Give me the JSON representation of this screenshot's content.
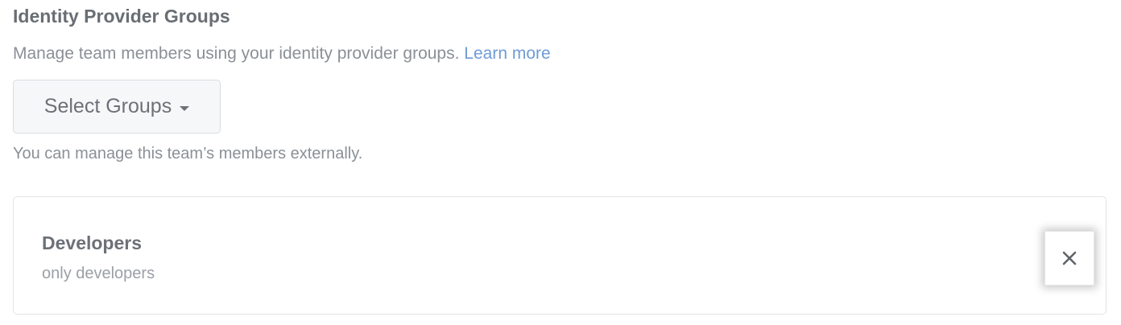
{
  "section": {
    "title": "Identity Provider Groups",
    "description": "Manage team members using your identity provider groups.",
    "learn_more": "Learn more",
    "select_button_label": "Select Groups",
    "helper_text": "You can manage this team’s members externally."
  },
  "group": {
    "name": "Developers",
    "description": "only developers"
  },
  "icons": {
    "caret": "chevron-down-icon",
    "remove": "close-icon"
  },
  "colors": {
    "link": "#6f9bd6",
    "text": "#696e74",
    "muted": "#8b9096"
  }
}
